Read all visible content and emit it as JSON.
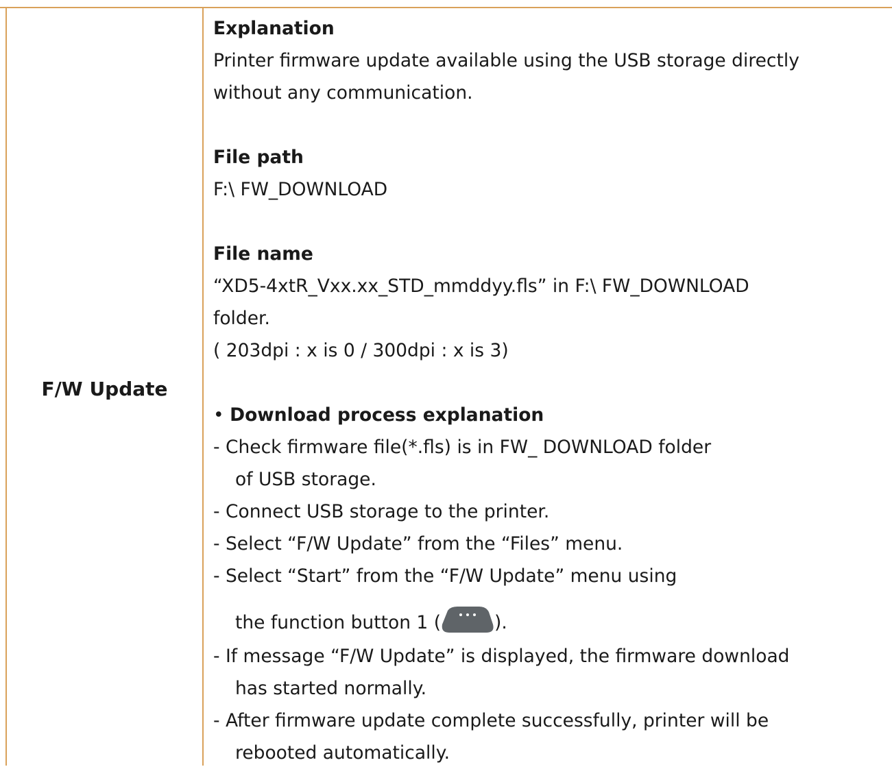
{
  "row": {
    "label": "F/W Update",
    "explanation_heading": "Explanation",
    "explanation_line1": "Printer firmware update available using the USB storage directly",
    "explanation_line2": "without any communication.",
    "file_path_heading": "File path",
    "file_path_value": "F:\\ FW_DOWNLOAD",
    "file_name_heading": "File name",
    "file_name_line1": "“XD5-4xtR_Vxx.xx_STD_mmddyy.fls” in F:\\ FW_DOWNLOAD",
    "file_name_line2": "folder.",
    "file_name_line3": "( 203dpi : x is 0 / 300dpi : x is 3)",
    "process_bullet": "•",
    "process_heading": "Download process explanation",
    "steps": {
      "s1a": "- Check firmware file(*.fls) is in FW_ DOWNLOAD folder",
      "s1b": "of USB storage.",
      "s2": "- Connect USB storage to the printer.",
      "s3": "- Select “F/W Update” from the “Files” menu.",
      "s4a": "- Select “Start” from the “F/W Update” menu using",
      "s4b_before": "the function button 1 (",
      "s4b_after": ").",
      "s5a": "- If message “F/W Update” is displayed, the firmware download",
      "s5b": "has started normally.",
      "s6a": "- After firmware update complete successfully, printer will be",
      "s6b": "rebooted automatically."
    }
  },
  "colors": {
    "border": "#d9a15a",
    "button": "#5f6468"
  },
  "icons": {
    "function_button": "function-button-1-icon"
  }
}
